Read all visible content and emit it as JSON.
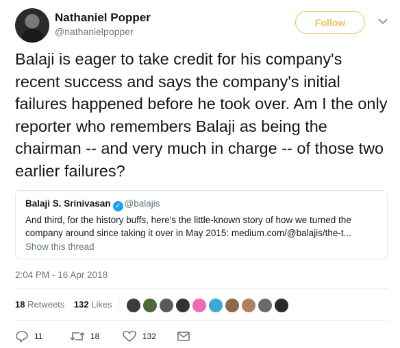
{
  "author": {
    "name": "Nathaniel Popper",
    "handle": "@nathanielpopper",
    "avatar_icon": "avatar-icon"
  },
  "follow_label": "Follow",
  "tweet_text": "Balaji is eager to take credit for his company's recent success and says the company's initial failures happened before he took over. Am I the only reporter who remembers Balaji as being the chairman -- and very much in charge -- of those two earlier failures?",
  "quoted": {
    "name": "Balaji S. Srinivasan",
    "handle": "@balajis",
    "verified": true,
    "text": "And third, for the history buffs, here's the little-known story of how we turned the company around since taking it over in May 2015: medium.com/@balajis/the-t...",
    "show_thread": "Show this thread"
  },
  "timestamp": "2:04 PM - 16 Apr 2018",
  "stats": {
    "retweets_count": "18",
    "retweets_label": "Retweets",
    "likes_count": "132",
    "likes_label": "Likes"
  },
  "actions": {
    "replies": "11",
    "retweets": "18",
    "likes": "132"
  },
  "colors": {
    "follow_accent": "#e8c25a",
    "verified": "#1da1f2",
    "secondary_text": "#657786"
  }
}
